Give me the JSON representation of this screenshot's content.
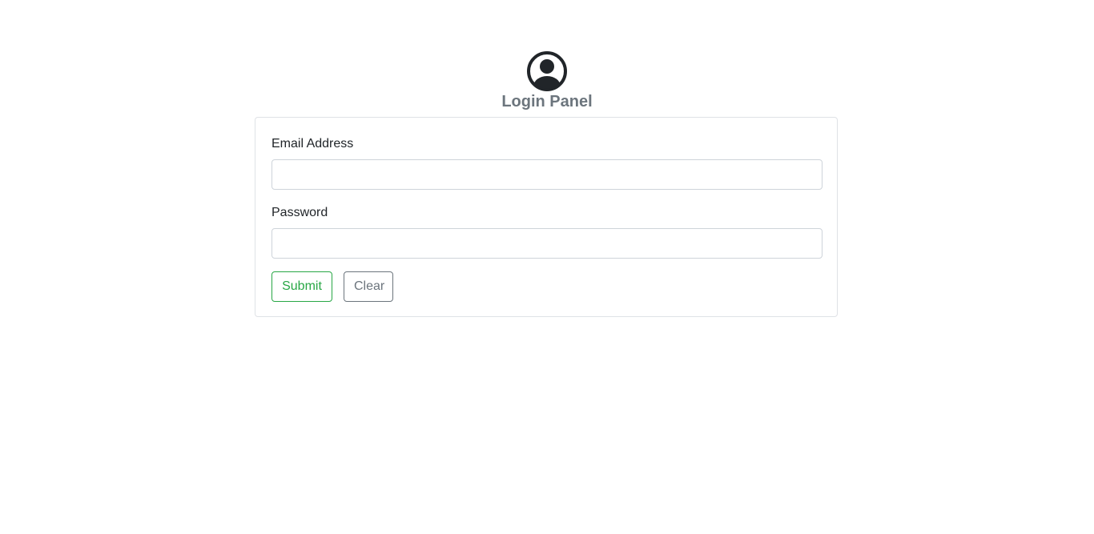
{
  "header": {
    "avatar_icon": "user-circle-icon",
    "title": "Login Panel"
  },
  "form": {
    "email": {
      "label": "Email Address",
      "value": "",
      "placeholder": ""
    },
    "password": {
      "label": "Password",
      "value": "",
      "placeholder": ""
    },
    "buttons": {
      "submit_label": "Submit",
      "clear_label": "Clear"
    }
  },
  "colors": {
    "title": "#6c757d",
    "submit_accent": "#28a745",
    "clear_accent": "#6c757d",
    "card_border": "#dfe2e6",
    "icon": "#212529"
  }
}
